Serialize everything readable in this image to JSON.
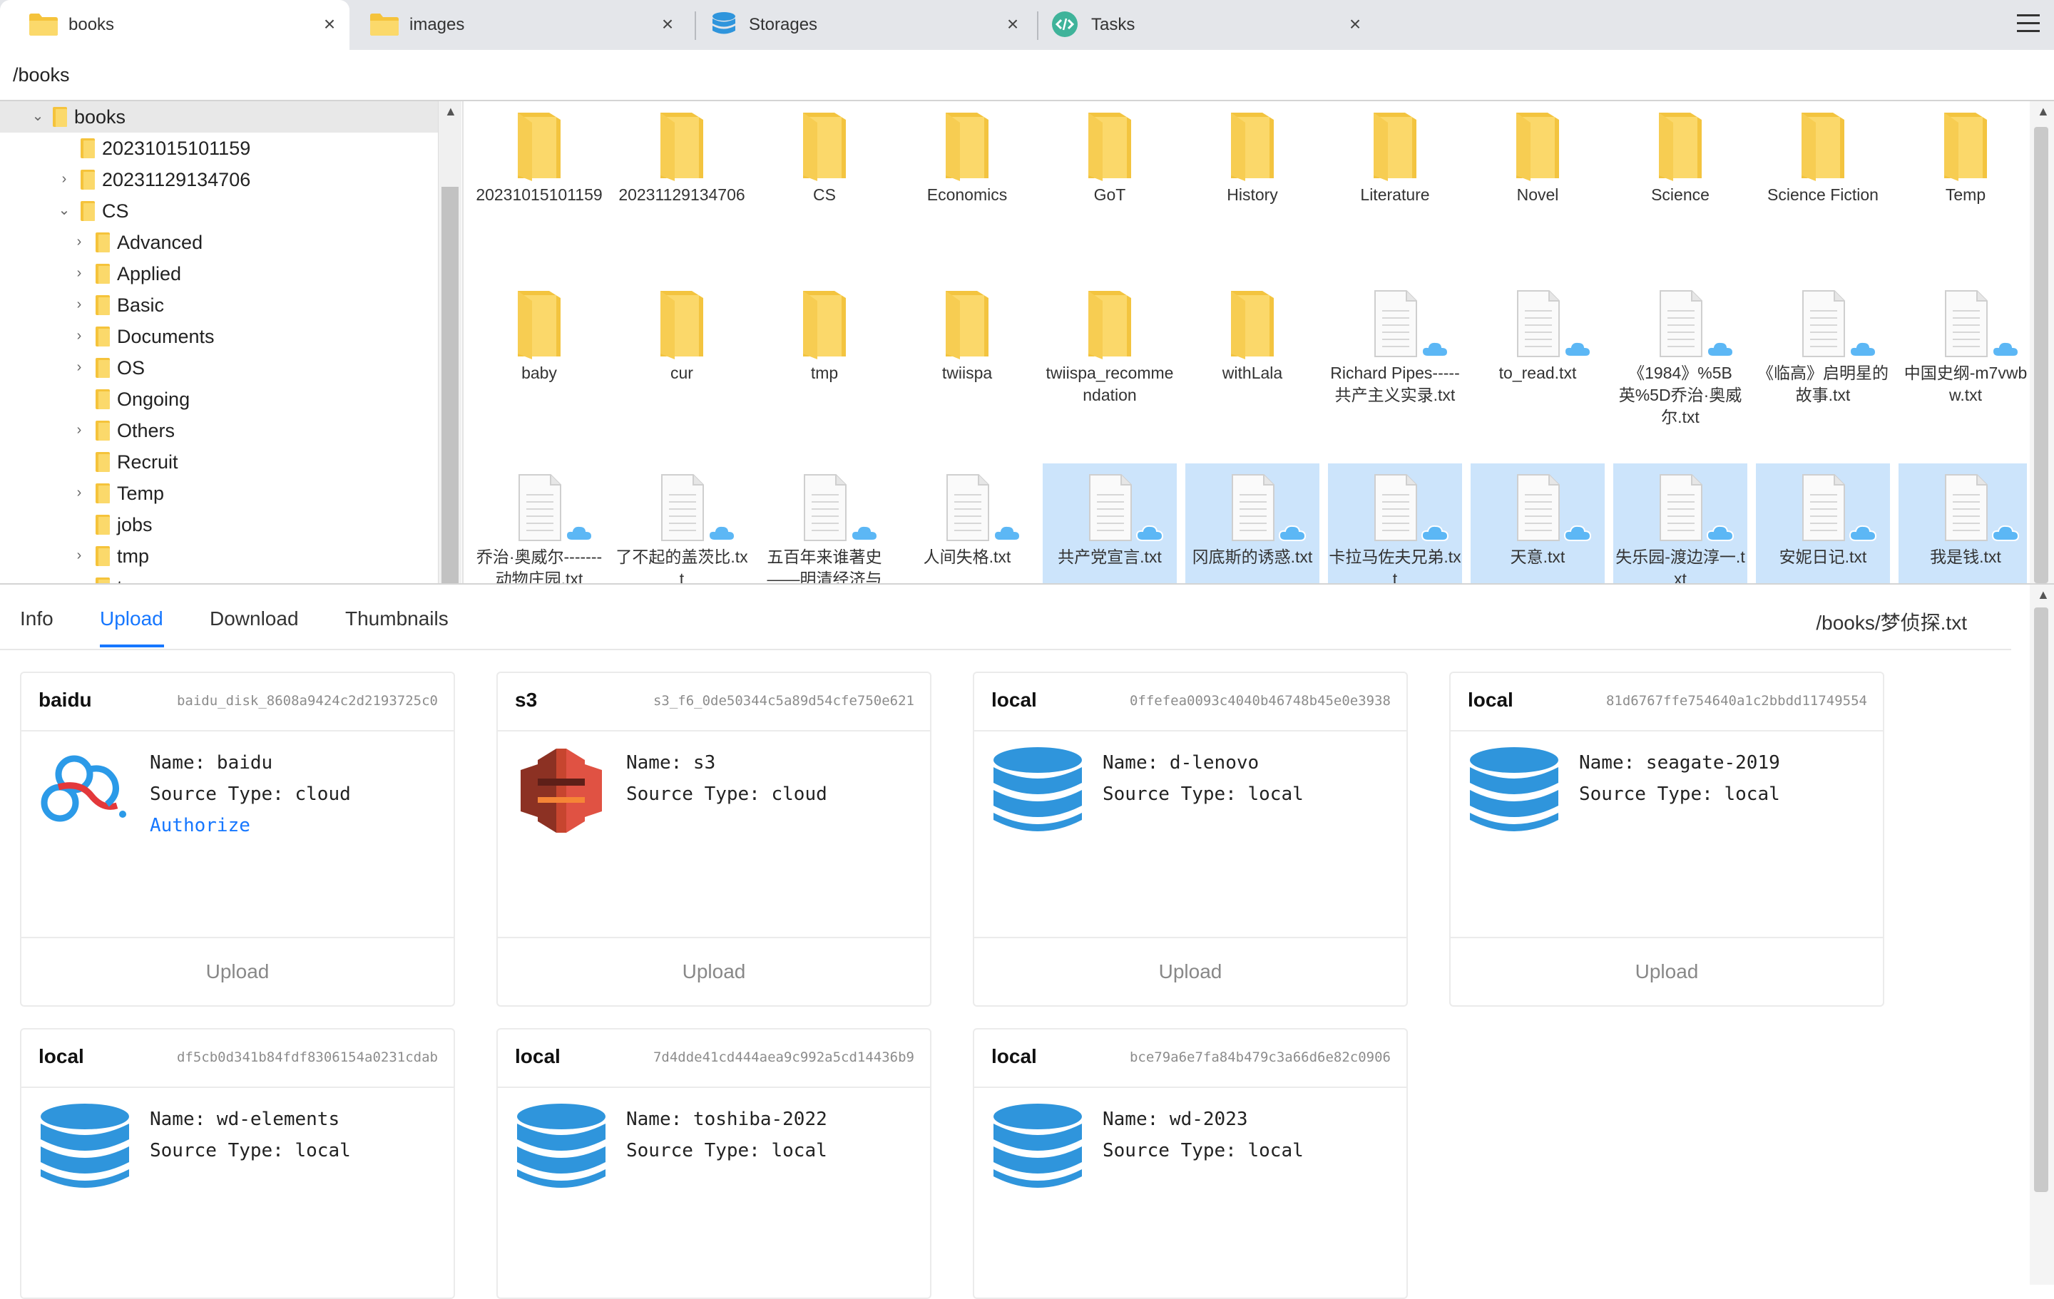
{
  "tabs": [
    {
      "label": "books",
      "icon": "folder-icon",
      "active": true
    },
    {
      "label": "images",
      "icon": "folder-icon",
      "active": false
    },
    {
      "label": "Storages",
      "icon": "database-icon",
      "active": false
    },
    {
      "label": "Tasks",
      "icon": "code-icon",
      "active": false
    }
  ],
  "tab_close_glyph": "×",
  "path": "/books",
  "tree": {
    "items": [
      {
        "label": "books",
        "expander": "expanded",
        "depth": 0,
        "selected": true
      },
      {
        "label": "20231015101159",
        "expander": "none",
        "depth": 1
      },
      {
        "label": "20231129134706",
        "expander": "collapsed",
        "depth": 1
      },
      {
        "label": "CS",
        "expander": "expanded",
        "depth": 1
      },
      {
        "label": "Advanced",
        "expander": "collapsed",
        "depth": 2
      },
      {
        "label": "Applied",
        "expander": "collapsed",
        "depth": 2
      },
      {
        "label": "Basic",
        "expander": "collapsed",
        "depth": 2
      },
      {
        "label": "Documents",
        "expander": "collapsed",
        "depth": 2
      },
      {
        "label": "OS",
        "expander": "collapsed",
        "depth": 2
      },
      {
        "label": "Ongoing",
        "expander": "none",
        "depth": 2
      },
      {
        "label": "Others",
        "expander": "collapsed",
        "depth": 2
      },
      {
        "label": "Recruit",
        "expander": "none",
        "depth": 2
      },
      {
        "label": "Temp",
        "expander": "collapsed",
        "depth": 2
      },
      {
        "label": "jobs",
        "expander": "none",
        "depth": 2
      },
      {
        "label": "tmp",
        "expander": "collapsed",
        "depth": 2
      },
      {
        "label": "tv",
        "expander": "none",
        "depth": 2
      }
    ]
  },
  "files": [
    {
      "name": "20231015101159",
      "kind": "folder"
    },
    {
      "name": "20231129134706",
      "kind": "folder"
    },
    {
      "name": "CS",
      "kind": "folder"
    },
    {
      "name": "Economics",
      "kind": "folder"
    },
    {
      "name": "GoT",
      "kind": "folder"
    },
    {
      "name": "History",
      "kind": "folder"
    },
    {
      "name": "Literature",
      "kind": "folder"
    },
    {
      "name": "Novel",
      "kind": "folder"
    },
    {
      "name": "Science",
      "kind": "folder"
    },
    {
      "name": "Science Fiction",
      "kind": "folder"
    },
    {
      "name": "Temp",
      "kind": "folder"
    },
    {
      "name": "baby",
      "kind": "folder"
    },
    {
      "name": "cur",
      "kind": "folder"
    },
    {
      "name": "tmp",
      "kind": "folder"
    },
    {
      "name": "twiispa",
      "kind": "folder"
    },
    {
      "name": "twiispa_recommendation",
      "kind": "folder"
    },
    {
      "name": "withLala",
      "kind": "folder"
    },
    {
      "name": "Richard Pipes-----共产主义实录.txt",
      "kind": "file",
      "cloud": true
    },
    {
      "name": "to_read.txt",
      "kind": "file",
      "cloud": true
    },
    {
      "name": "《1984》%5B英%5D乔治·奥威尔.txt",
      "kind": "file",
      "cloud": true
    },
    {
      "name": "《临高》启明星的故事.txt",
      "kind": "file",
      "cloud": true
    },
    {
      "name": "中国史纲-m7vwbw.txt",
      "kind": "file",
      "cloud": true
    },
    {
      "name": "乔治·奥威尔-------动物庄园.txt",
      "kind": "file",
      "cloud": true
    },
    {
      "name": "了不起的盖茨比.txt",
      "kind": "file",
      "cloud": true
    },
    {
      "name": "五百年来谁著史——明清经济与",
      "kind": "file",
      "cloud": true
    },
    {
      "name": "人间失格.txt",
      "kind": "file",
      "cloud": true
    },
    {
      "name": "共产党宣言.txt",
      "kind": "file",
      "cloud": true,
      "selected": true
    },
    {
      "name": "冈底斯的诱惑.txt",
      "kind": "file",
      "cloud": true,
      "selected": true
    },
    {
      "name": "卡拉马佐夫兄弟.txt",
      "kind": "file",
      "cloud": true,
      "selected": true
    },
    {
      "name": "天意.txt",
      "kind": "file",
      "cloud": true,
      "selected": true
    },
    {
      "name": "失乐园-渡边淳一.txt",
      "kind": "file",
      "cloud": true,
      "selected": true
    },
    {
      "name": "安妮日记.txt",
      "kind": "file",
      "cloud": true,
      "selected": true
    },
    {
      "name": "我是钱.txt",
      "kind": "file",
      "cloud": true,
      "selected": true
    }
  ],
  "bottom": {
    "tabs": [
      "Info",
      "Upload",
      "Download",
      "Thumbnails"
    ],
    "active_tab": "Upload",
    "path": "/books/梦侦探.txt"
  },
  "name_prefix": "Name: ",
  "source_prefix": "Source Type: ",
  "upload_label": "Upload",
  "cards": [
    {
      "type": "baidu",
      "id": "baidu_disk_8608a9424c2d2193725c0",
      "name": "baidu",
      "source": "cloud",
      "icon": "baidu-cloud-icon",
      "link": "Authorize"
    },
    {
      "type": "s3",
      "id": "s3_f6_0de50344c5a89d54cfe750e621",
      "name": "s3",
      "source": "cloud",
      "icon": "aws-s3-icon"
    },
    {
      "type": "local",
      "id": "0ffefea0093c4040b46748b45e0e3938",
      "name": "d-lenovo",
      "source": "local",
      "icon": "database-icon"
    },
    {
      "type": "local",
      "id": "81d6767ffe754640a1c2bbdd11749554",
      "name": "seagate-2019",
      "source": "local",
      "icon": "database-icon"
    },
    {
      "type": "local",
      "id": "df5cb0d341b84fdf8306154a0231cdab",
      "name": "wd-elements",
      "source": "local",
      "icon": "database-icon"
    },
    {
      "type": "local",
      "id": "7d4dde41cd444aea9c992a5cd14436b9",
      "name": "toshiba-2022",
      "source": "local",
      "icon": "database-icon"
    },
    {
      "type": "local",
      "id": "bce79a6e7fa84b479c3a66d6e82c0906",
      "name": "wd-2023",
      "source": "local",
      "icon": "database-icon"
    }
  ],
  "colors": {
    "accent": "#1677ff",
    "selection": "#cce4fb",
    "folder": "#f7d36b",
    "storage_blue": "#2f95dc"
  }
}
